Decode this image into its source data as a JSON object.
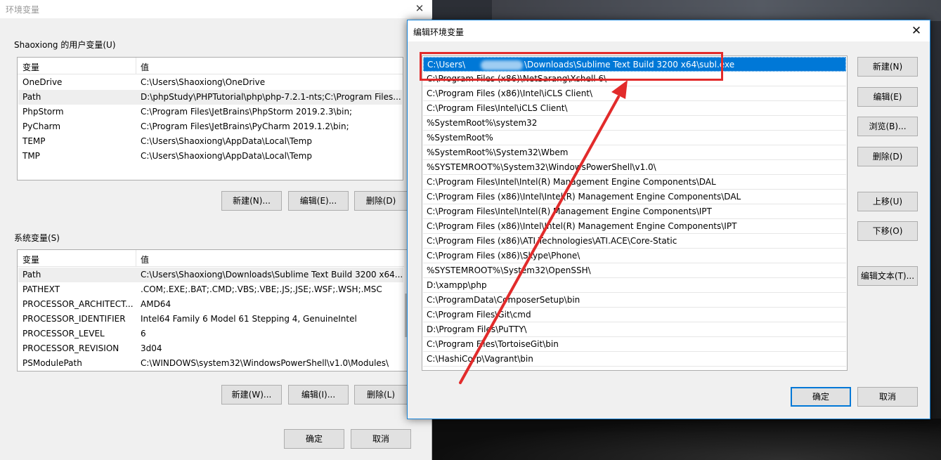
{
  "env_window": {
    "title": "环境变量",
    "user_group_label": "Shaoxiong 的用户变量(U)",
    "system_group_label": "系统变量(S)",
    "col_variable": "变量",
    "col_value": "值",
    "user_vars": [
      {
        "name": "OneDrive",
        "value": "C:\\Users\\Shaoxiong\\OneDrive"
      },
      {
        "name": "Path",
        "value": "D:\\phpStudy\\PHPTutorial\\php\\php-7.2.1-nts;C:\\Program Files..."
      },
      {
        "name": "PhpStorm",
        "value": "C:\\Program Files\\JetBrains\\PhpStorm 2019.2.3\\bin;"
      },
      {
        "name": "PyCharm",
        "value": "C:\\Program Files\\JetBrains\\PyCharm 2019.1.2\\bin;"
      },
      {
        "name": "TEMP",
        "value": "C:\\Users\\Shaoxiong\\AppData\\Local\\Temp"
      },
      {
        "name": "TMP",
        "value": "C:\\Users\\Shaoxiong\\AppData\\Local\\Temp"
      }
    ],
    "user_buttons": {
      "new": "新建(N)...",
      "edit": "编辑(E)...",
      "delete": "删除(D)"
    },
    "system_vars": [
      {
        "name": "Path",
        "value": "C:\\Users\\Shaoxiong\\Downloads\\Sublime Text Build 3200 x64..."
      },
      {
        "name": "PATHEXT",
        "value": ".COM;.EXE;.BAT;.CMD;.VBS;.VBE;.JS;.JSE;.WSF;.WSH;.MSC"
      },
      {
        "name": "PROCESSOR_ARCHITECT...",
        "value": "AMD64"
      },
      {
        "name": "PROCESSOR_IDENTIFIER",
        "value": "Intel64 Family 6 Model 61 Stepping 4, GenuineIntel"
      },
      {
        "name": "PROCESSOR_LEVEL",
        "value": "6"
      },
      {
        "name": "PROCESSOR_REVISION",
        "value": "3d04"
      },
      {
        "name": "PSModulePath",
        "value": "C:\\WINDOWS\\system32\\WindowsPowerShell\\v1.0\\Modules\\"
      }
    ],
    "system_buttons": {
      "new": "新建(W)...",
      "edit": "编辑(I)...",
      "delete": "删除(L)"
    },
    "ok": "确定",
    "cancel": "取消"
  },
  "edit_window": {
    "title": "编辑环境变量",
    "selected_prefix": "C:\\Users\\",
    "selected_suffix": "\\Downloads\\Sublime Text Build 3200 x64\\subl.exe",
    "paths": [
      "C:\\Program Files (x86)\\NetSarang\\Xshell 6\\",
      "C:\\Program Files (x86)\\Intel\\iCLS Client\\",
      "C:\\Program Files\\Intel\\iCLS Client\\",
      "%SystemRoot%\\system32",
      "%SystemRoot%",
      "%SystemRoot%\\System32\\Wbem",
      "%SYSTEMROOT%\\System32\\WindowsPowerShell\\v1.0\\",
      "C:\\Program Files\\Intel\\Intel(R) Management Engine Components\\DAL",
      "C:\\Program Files (x86)\\Intel\\Intel(R) Management Engine Components\\DAL",
      "C:\\Program Files\\Intel\\Intel(R) Management Engine Components\\IPT",
      "C:\\Program Files (x86)\\Intel\\Intel(R) Management Engine Components\\IPT",
      "C:\\Program Files (x86)\\ATI Technologies\\ATI.ACE\\Core-Static",
      "C:\\Program Files (x86)\\Skype\\Phone\\",
      "%SYSTEMROOT%\\System32\\OpenSSH\\",
      "D:\\xampp\\php",
      "C:\\ProgramData\\ComposerSetup\\bin",
      "C:\\Program Files\\Git\\cmd",
      "D:\\Program Files\\PuTTY\\",
      "C:\\Program Files\\TortoiseGit\\bin",
      "C:\\HashiCorp\\Vagrant\\bin"
    ],
    "buttons": {
      "new": "新建(N)",
      "edit": "编辑(E)",
      "browse": "浏览(B)...",
      "delete": "删除(D)",
      "move_up": "上移(U)",
      "move_down": "下移(O)",
      "edit_text": "编辑文本(T)..."
    },
    "ok": "确定",
    "cancel": "取消"
  },
  "annotation_color": "#e22b2b"
}
